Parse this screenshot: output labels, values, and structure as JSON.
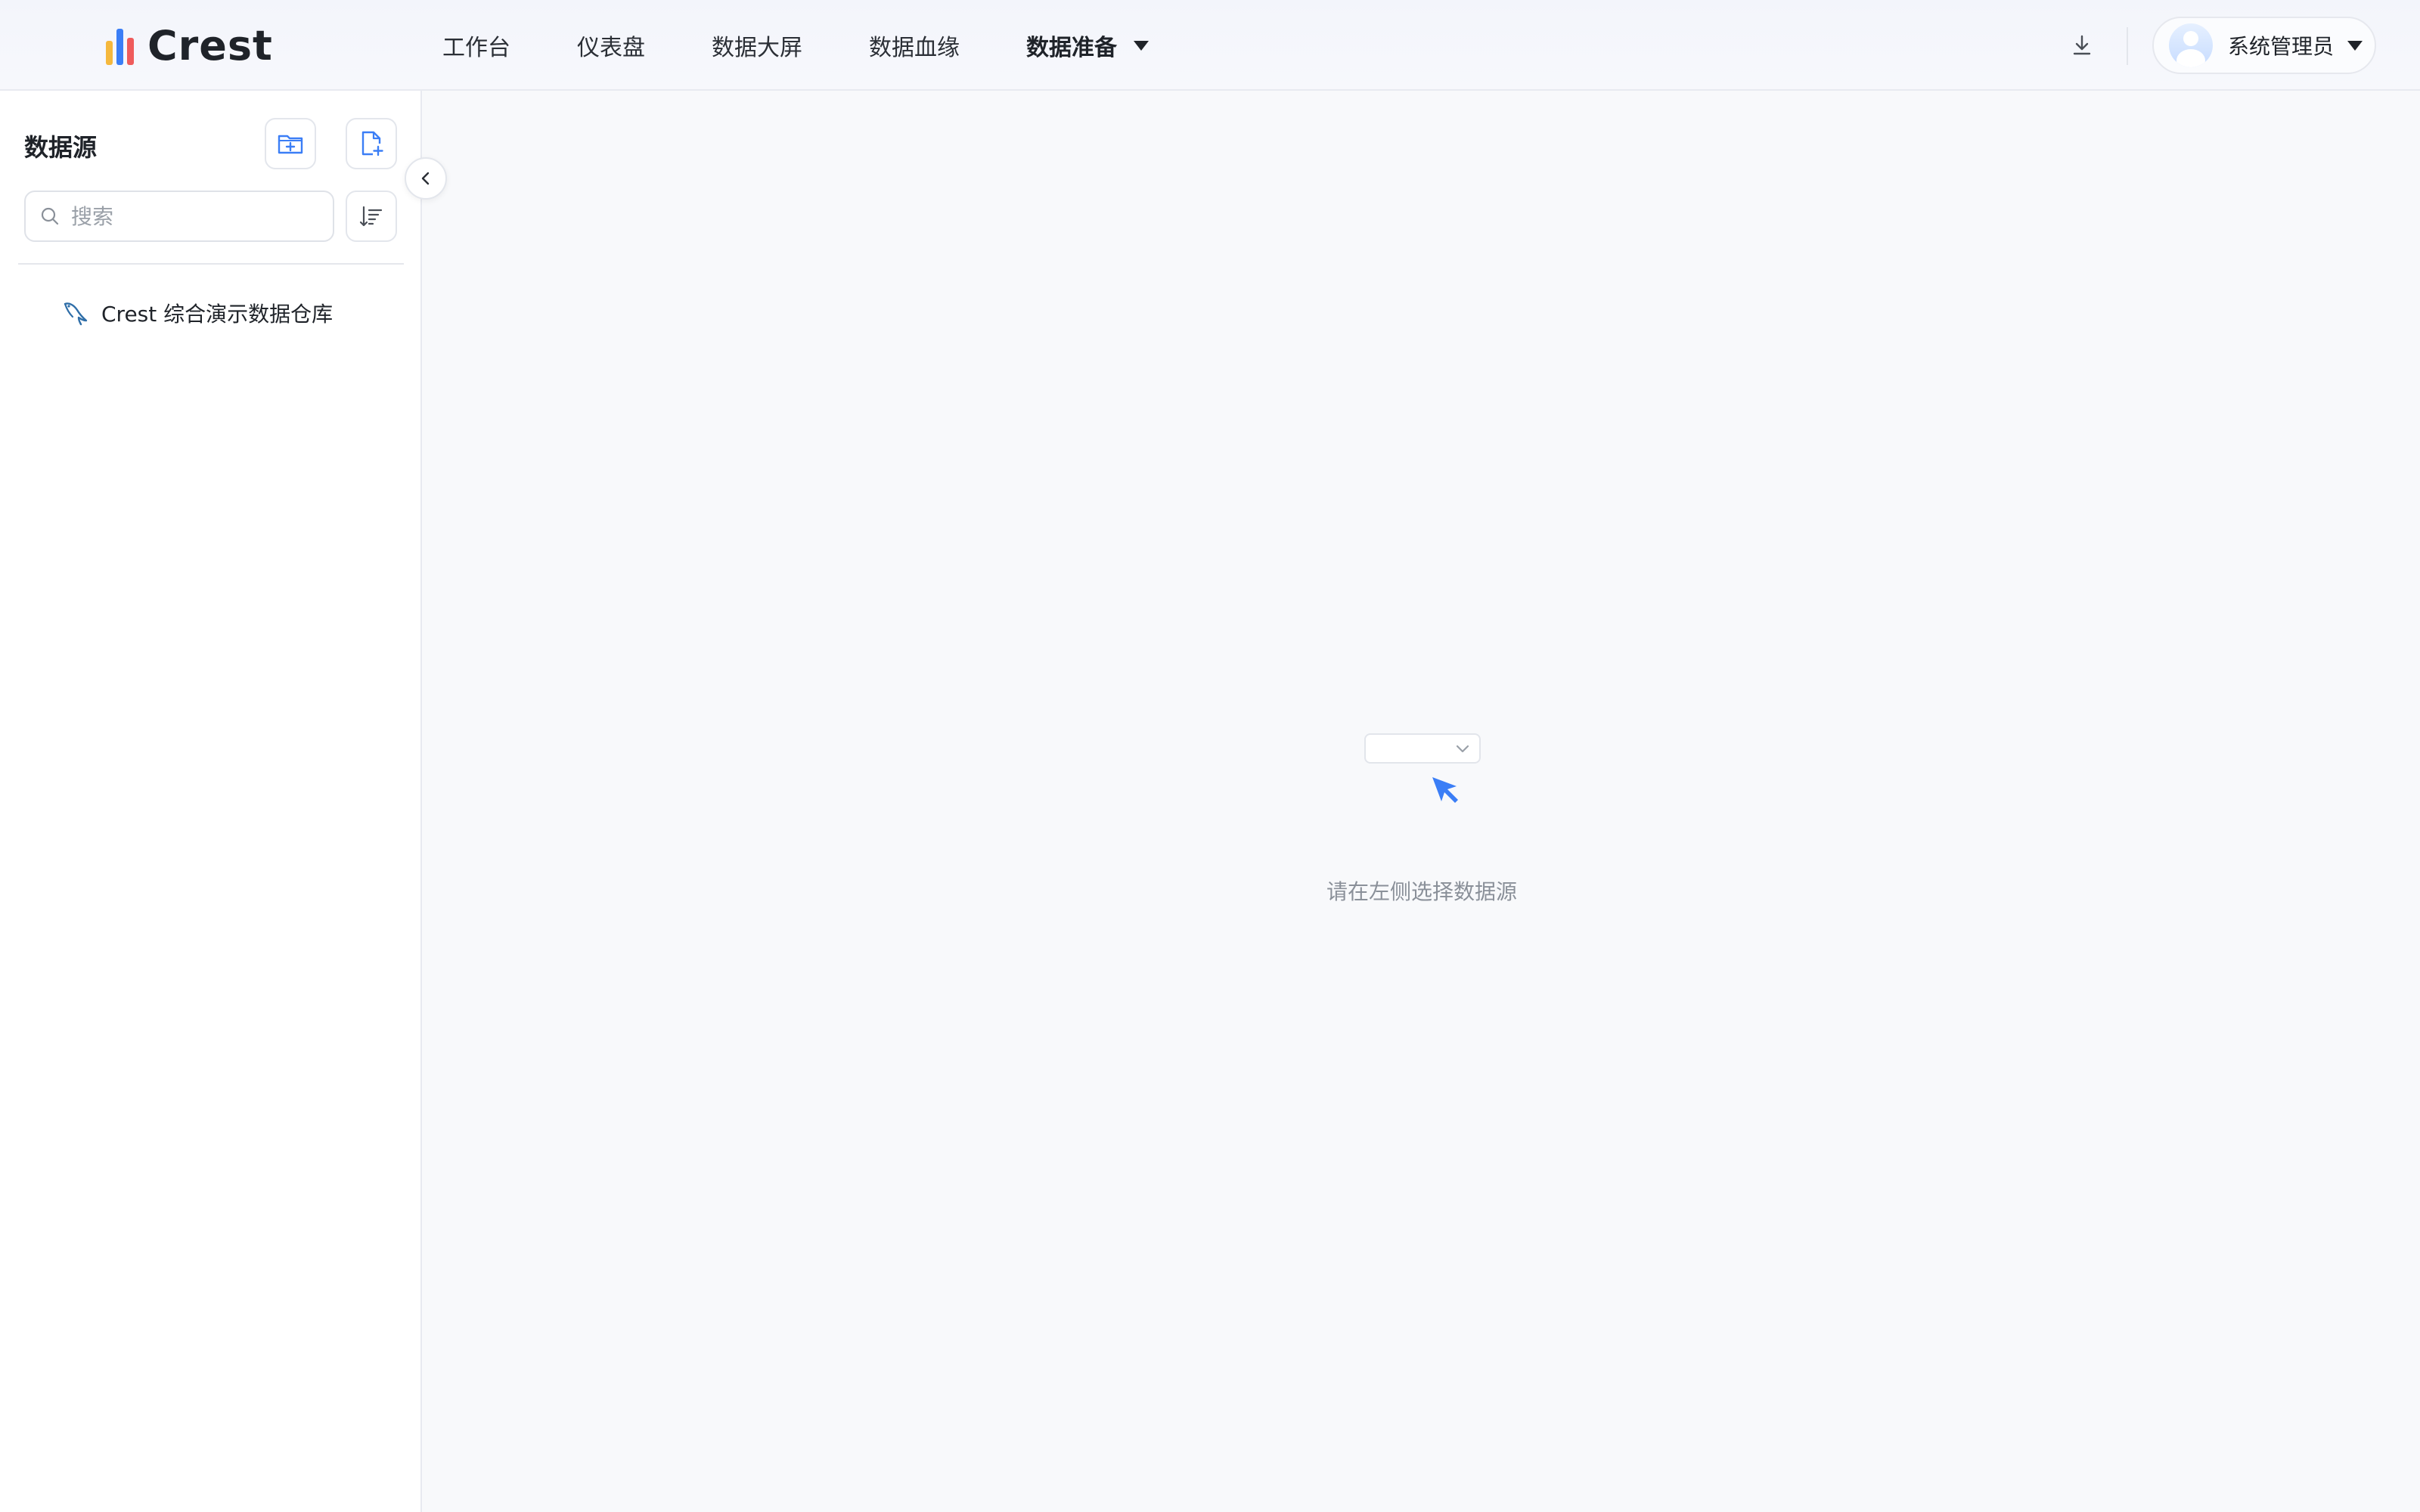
{
  "app": {
    "name": "Crest"
  },
  "nav": {
    "items": [
      {
        "label": "工作台"
      },
      {
        "label": "仪表盘"
      },
      {
        "label": "数据大屏"
      },
      {
        "label": "数据血缘"
      },
      {
        "label": "数据准备"
      }
    ],
    "active": "数据准备"
  },
  "user": {
    "name": "系统管理员"
  },
  "sidebar": {
    "title": "数据源",
    "search_placeholder": "搜索",
    "tree": [
      {
        "label": "Crest 综合演示数据仓库",
        "icon": "mysql-icon"
      }
    ]
  },
  "main": {
    "empty_message": "请在左侧选择数据源"
  },
  "colors": {
    "accent": "#3b7ef6",
    "logo_bars": [
      "#f5b83d",
      "#3b7ef6",
      "#ef5b5b"
    ]
  }
}
